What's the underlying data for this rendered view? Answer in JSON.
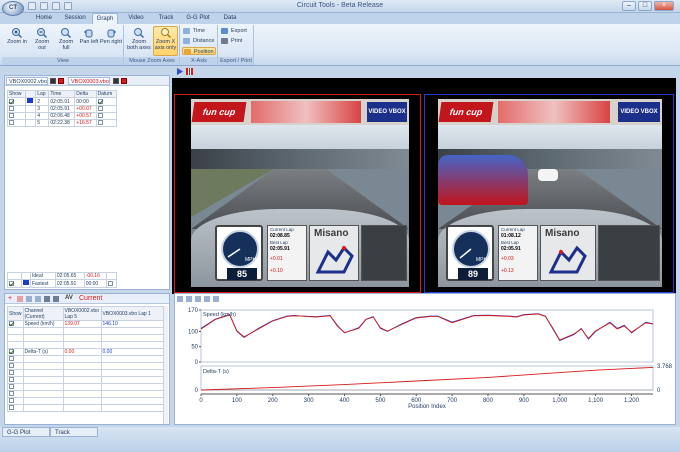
{
  "window": {
    "title": "Circuit Tools - Beta Release",
    "orb_label": "CT"
  },
  "tabs": [
    "Home",
    "Session",
    "Graph",
    "Video",
    "Track",
    "G-G Plot",
    "Data"
  ],
  "active_tab": "Graph",
  "ribbon": {
    "groups": [
      {
        "label": "View",
        "buttons": [
          {
            "label": "Zoom in"
          },
          {
            "label": "Zoom out"
          },
          {
            "label": "Zoom full"
          },
          {
            "label": "Pan left"
          },
          {
            "label": "Pen right"
          }
        ]
      },
      {
        "label": "Mouse Zoom Axes",
        "buttons": [
          {
            "label": "Zoom both axes"
          },
          {
            "label": "Zoom X axis only"
          }
        ]
      },
      {
        "label": "X-Axis",
        "buttons": [
          {
            "label": "Time"
          },
          {
            "label": "Distance"
          },
          {
            "label": "Position"
          }
        ]
      },
      {
        "label": "Export / Print",
        "buttons": [
          {
            "label": "Export"
          },
          {
            "label": "Print"
          }
        ]
      }
    ]
  },
  "files": {
    "file1": "VBOX0002.vbo",
    "file2": "VBOX0003.vbo"
  },
  "lap_table": {
    "headers": [
      "Show",
      "",
      "Lap",
      "Time",
      "Delta",
      "Datum"
    ],
    "rows": [
      {
        "lap": "2",
        "time": "02:05.91",
        "delta": "00:00",
        "show": true,
        "datum": true
      },
      {
        "lap": "3",
        "time": "02:05.91",
        "delta": "+00.07",
        "show": false,
        "datum": false
      },
      {
        "lap": "4",
        "time": "02:06.48",
        "delta": "+00.57",
        "show": false,
        "datum": false
      },
      {
        "lap": "5",
        "time": "02:22.38",
        "delta": "+16.57",
        "show": false,
        "datum": false
      }
    ],
    "footer": [
      {
        "label": "Ideal",
        "time": "02:05.65",
        "delta": "-00.16"
      },
      {
        "label": "Fastest",
        "time": "02:05.91",
        "delta": "00:00"
      }
    ]
  },
  "video": {
    "left": {
      "logo": "fun cup",
      "brand": "VIDEO VBOX",
      "speed": "85",
      "unit": "MPH",
      "current_lap_label": "Current Lap",
      "current_lap": "02:08.85",
      "best_lap_label": "Best Lap",
      "best_lap": "02:05.91",
      "delta_top": "+0.01",
      "delta_bottom": "+0.10",
      "circuit": "Misano"
    },
    "right": {
      "logo": "fun cup",
      "brand": "VIDEO VBOX",
      "speed": "89",
      "unit": "MPH",
      "current_lap_label": "Current Lap",
      "current_lap": "01:08.12",
      "best_lap_label": "Best Lap",
      "best_lap": "02:05.91",
      "delta_top": "+0.03",
      "delta_bottom": "+0.13",
      "circuit": "Misano"
    }
  },
  "channels": {
    "title": "Current",
    "headers": [
      "Show",
      "Channel (Current)",
      "VBOX0002.vbo Lap 5",
      "VBOX0003.vbo Lap 1"
    ],
    "rows": [
      {
        "name": "Speed (km/h)",
        "v1": "139.07",
        "v2": "146.10",
        "show": true
      },
      {
        "name": "Delta-T (s)",
        "v1": "0.00",
        "v2": "0.00",
        "show": true
      }
    ]
  },
  "chart_data": {
    "type": "line",
    "xlabel": "Position Index",
    "x_ticks": [
      "0",
      "100",
      "200",
      "300",
      "400",
      "500",
      "600",
      "700",
      "800",
      "900",
      "1,000",
      "1,100",
      "1,200"
    ],
    "xlim": [
      0,
      1260
    ],
    "speed": {
      "label": "Speed (km/h)",
      "ylim": [
        0,
        170
      ],
      "y_ticks": [
        "170",
        "100",
        "50",
        "0"
      ],
      "series": [
        {
          "color": "#1d3ad0",
          "x": [
            0,
            40,
            80,
            100,
            120,
            160,
            200,
            240,
            260,
            280,
            320,
            360,
            380,
            400,
            440,
            460,
            480,
            500,
            520,
            560,
            600,
            640,
            660,
            700,
            760,
            800,
            860,
            880,
            900,
            940,
            960,
            980,
            1000,
            1040,
            1060,
            1080,
            1100,
            1140,
            1160,
            1180,
            1200,
            1240,
            1260
          ],
          "y": [
            110,
            140,
            155,
            100,
            80,
            110,
            135,
            150,
            152,
            150,
            148,
            152,
            120,
            95,
            112,
            140,
            148,
            110,
            100,
            125,
            145,
            150,
            150,
            130,
            152,
            153,
            150,
            148,
            155,
            158,
            150,
            110,
            70,
            90,
            110,
            75,
            100,
            130,
            110,
            120,
            95,
            130,
            125
          ]
        },
        {
          "color": "#d71a1a",
          "x": [
            0,
            40,
            80,
            100,
            120,
            160,
            200,
            240,
            260,
            280,
            320,
            360,
            380,
            400,
            440,
            460,
            480,
            500,
            520,
            560,
            600,
            640,
            660,
            700,
            760,
            800,
            860,
            880,
            900,
            940,
            960,
            980,
            1000,
            1040,
            1060,
            1080,
            1100,
            1140,
            1160,
            1180,
            1200,
            1240,
            1260
          ],
          "y": [
            108,
            139,
            154,
            102,
            82,
            108,
            134,
            149,
            151,
            150,
            147,
            151,
            118,
            96,
            110,
            139,
            147,
            112,
            101,
            123,
            144,
            149,
            149,
            128,
            151,
            152,
            149,
            147,
            154,
            157,
            149,
            112,
            72,
            92,
            108,
            77,
            102,
            128,
            108,
            118,
            97,
            128,
            124
          ]
        }
      ]
    },
    "delta": {
      "label": "Delta-T (s)",
      "right_value": "3.768",
      "baseline": "0",
      "series": [
        {
          "color": "#d71a1a",
          "x": [
            0,
            200,
            400,
            600,
            800,
            1000,
            1100,
            1200,
            1260
          ],
          "y": [
            0,
            0.4,
            0.9,
            1.5,
            2.1,
            2.9,
            3.3,
            3.6,
            3.768
          ]
        }
      ]
    }
  },
  "status_tabs": [
    "G-G Plot",
    "Track"
  ]
}
